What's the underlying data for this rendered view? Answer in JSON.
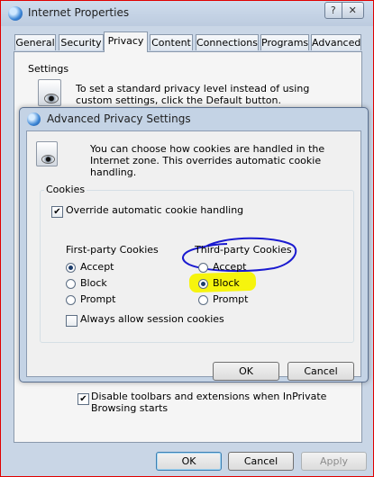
{
  "window": {
    "title": "Internet Properties",
    "help_glyph": "?",
    "close_glyph": "✕"
  },
  "tabs": [
    {
      "label": "General"
    },
    {
      "label": "Security"
    },
    {
      "label": "Privacy",
      "active": true
    },
    {
      "label": "Content"
    },
    {
      "label": "Connections"
    },
    {
      "label": "Programs"
    },
    {
      "label": "Advanced"
    }
  ],
  "privacy": {
    "settings_label": "Settings",
    "standard_desc": "To set a standard privacy level instead of using custom settings, click the Default button.",
    "inprivate_checkbox_label": "Disable toolbars and extensions when InPrivate Browsing starts",
    "inprivate_checked": true
  },
  "footer_buttons": {
    "ok": "OK",
    "cancel": "Cancel",
    "apply": "Apply"
  },
  "advanced_dialog": {
    "title": "Advanced Privacy Settings",
    "description": "You can choose how cookies are handled in the Internet zone.  This overrides automatic cookie handling.",
    "group_label": "Cookies",
    "override_label": "Override automatic cookie handling",
    "override_checked": true,
    "first_party": {
      "label": "First-party Cookies",
      "options": [
        "Accept",
        "Block",
        "Prompt"
      ],
      "selected": "Accept"
    },
    "third_party": {
      "label": "Third-party Cookies",
      "options": [
        "Accept",
        "Block",
        "Prompt"
      ],
      "selected": "Block"
    },
    "session_label": "Always allow session cookies",
    "session_checked": false,
    "ok": "OK",
    "cancel": "Cancel"
  },
  "annotations": {
    "circle_color": "#1a1ad0",
    "highlight_color": "#f6f300"
  },
  "colors": {
    "frame_border": "#e00000",
    "title_bar": "#c9d6e6"
  }
}
